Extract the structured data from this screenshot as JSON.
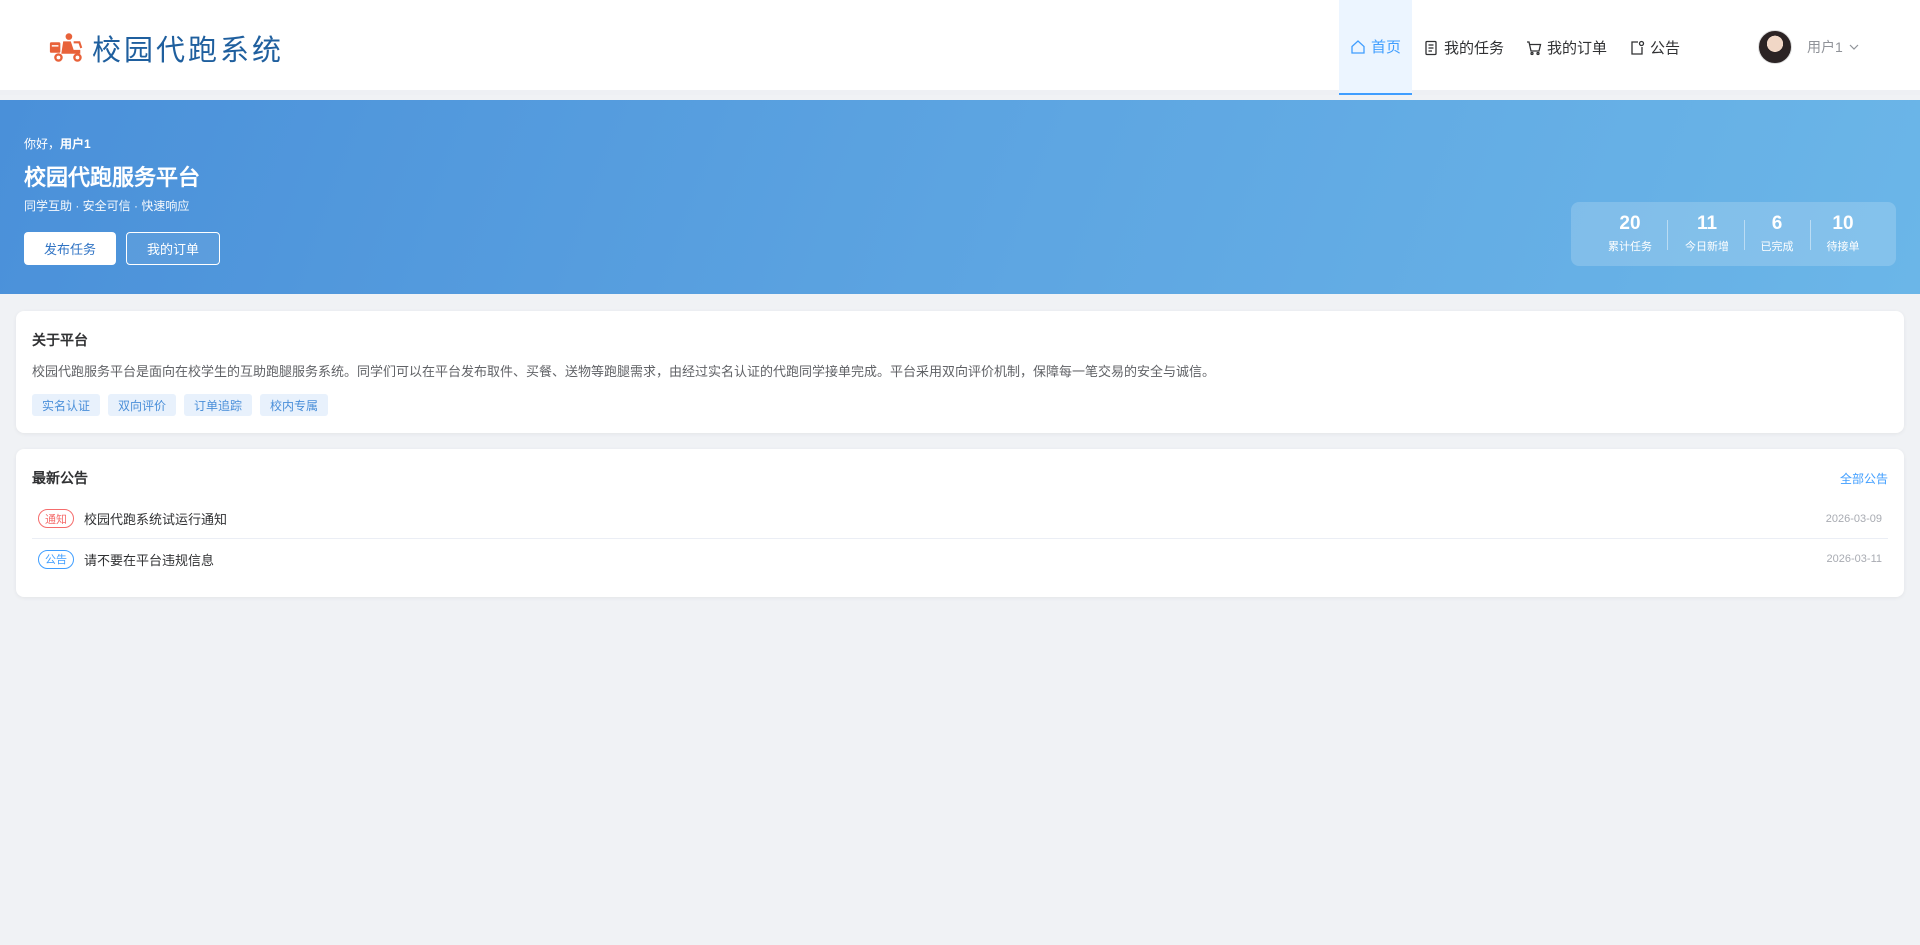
{
  "app": {
    "title": "校园代跑系统",
    "nav": [
      {
        "label": "首页",
        "icon": "home-icon",
        "active": true
      },
      {
        "label": "我的任务",
        "icon": "document-icon",
        "active": false
      },
      {
        "label": "我的订单",
        "icon": "cart-icon",
        "active": false
      },
      {
        "label": "公告",
        "icon": "notice-icon",
        "active": false
      }
    ],
    "user": {
      "name": "用户1"
    }
  },
  "banner": {
    "greeting_prefix": "你好，",
    "greeting_name": "用户1",
    "title": "校园代跑服务平台",
    "subtitle": "同学互助 · 安全可信 · 快速响应",
    "publish_button": "发布任务",
    "orders_button": "我的订单",
    "stats": [
      {
        "value": "20",
        "label": "累计任务"
      },
      {
        "value": "11",
        "label": "今日新增"
      },
      {
        "value": "6",
        "label": "已完成"
      },
      {
        "value": "10",
        "label": "待接单"
      }
    ]
  },
  "about": {
    "title": "关于平台",
    "text": "校园代跑服务平台是面向在校学生的互助跑腿服务系统。同学们可以在平台发布取件、买餐、送物等跑腿需求，由经过实名认证的代跑同学接单完成。平台采用双向评价机制，保障每一笔交易的安全与诚信。",
    "tags": [
      "实名认证",
      "双向评价",
      "订单追踪",
      "校内专属"
    ]
  },
  "notices": {
    "title": "最新公告",
    "all_link": "全部公告",
    "items": [
      {
        "badge": "通知",
        "title": "校园代跑系统试运行通知",
        "date": "2026-03-09"
      },
      {
        "badge": "公告",
        "title": "请不要在平台违规信息",
        "date": "2026-03-11"
      }
    ]
  },
  "colors": {
    "primary": "#409eff",
    "brand_text": "#1f5f9e",
    "banner_start": "#4a90d9",
    "banner_end": "#6bb6e8",
    "notice_badge": "#f56c6c",
    "announce_badge": "#409eff"
  }
}
